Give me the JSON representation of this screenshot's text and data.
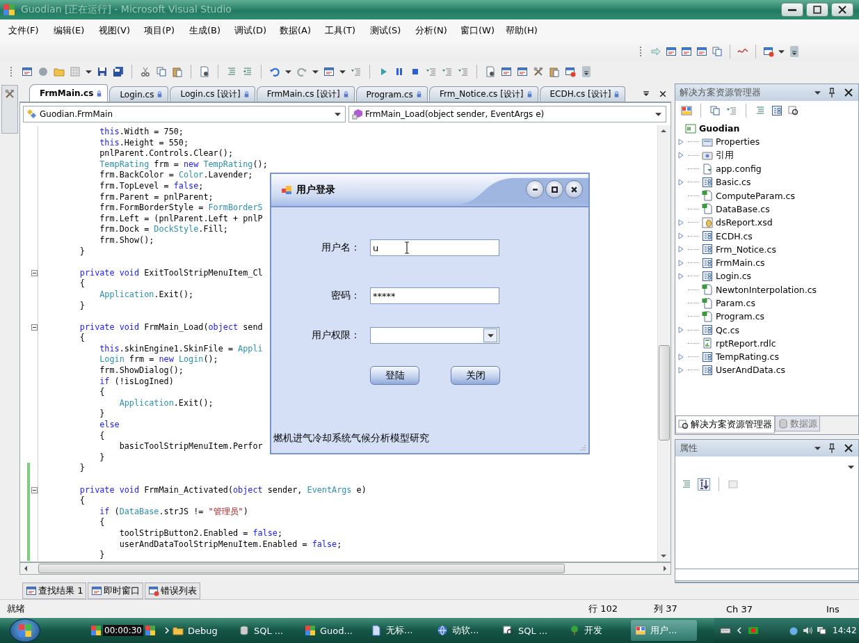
{
  "window": {
    "title": "Guodian [正在运行] - Microsoft Visual Studio"
  },
  "menu": [
    "文件(F)",
    "编辑(E)",
    "视图(V)",
    "项目(P)",
    "生成(B)",
    "调试(D)",
    "数据(A)",
    "工具(T)",
    "测试(S)",
    "分析(N)",
    "窗口(W)",
    "帮助(H)"
  ],
  "editor_tabs": [
    {
      "label": "FrmMain.cs",
      "selected": true
    },
    {
      "label": "Login.cs",
      "selected": false
    },
    {
      "label": "Login.cs [设计]",
      "selected": false
    },
    {
      "label": "FrmMain.cs [设计]",
      "selected": false
    },
    {
      "label": "Program.cs",
      "selected": false
    },
    {
      "label": "Frm_Notice.cs [设计]",
      "selected": false
    },
    {
      "label": "ECDH.cs [设计]",
      "selected": false
    }
  ],
  "type_dropdown": {
    "value": "Guodian.FrmMain"
  },
  "member_dropdown": {
    "value": "FrmMain_Load(object sender, EventArgs e)"
  },
  "code_lines": [
    {
      "tokens": [
        {
          "kind": "keyword",
          "text": "            this"
        },
        {
          "kind": "plain",
          "text": ".Width = 750;"
        }
      ],
      "fold": false,
      "changed": false
    },
    {
      "tokens": [
        {
          "kind": "keyword",
          "text": "            this"
        },
        {
          "kind": "plain",
          "text": ".Height = 550;"
        }
      ],
      "fold": false,
      "changed": false
    },
    {
      "tokens": [
        {
          "kind": "plain",
          "text": "            pnlParent.Controls.Clear();"
        }
      ],
      "fold": false,
      "changed": false
    },
    {
      "tokens": [
        {
          "kind": "type",
          "text": "            TempRating"
        },
        {
          "kind": "plain",
          "text": " frm = "
        },
        {
          "kind": "keyword",
          "text": "new "
        },
        {
          "kind": "type",
          "text": "TempRating"
        },
        {
          "kind": "plain",
          "text": "();"
        }
      ],
      "fold": false,
      "changed": false
    },
    {
      "tokens": [
        {
          "kind": "plain",
          "text": "            frm.BackColor = "
        },
        {
          "kind": "type",
          "text": "Color"
        },
        {
          "kind": "plain",
          "text": ".Lavender;"
        }
      ],
      "fold": false,
      "changed": false
    },
    {
      "tokens": [
        {
          "kind": "plain",
          "text": "            frm.TopLevel = "
        },
        {
          "kind": "keyword",
          "text": "false"
        },
        {
          "kind": "plain",
          "text": ";"
        }
      ],
      "fold": false,
      "changed": false
    },
    {
      "tokens": [
        {
          "kind": "plain",
          "text": "            frm.Parent = pnlParent;"
        }
      ],
      "fold": false,
      "changed": false
    },
    {
      "tokens": [
        {
          "kind": "plain",
          "text": "            frm.FormBorderStyle = "
        },
        {
          "kind": "type",
          "text": "FormBorderS"
        }
      ],
      "fold": false,
      "changed": false
    },
    {
      "tokens": [
        {
          "kind": "plain",
          "text": "            frm.Left = (pnlParent.Left + pnlP"
        }
      ],
      "fold": false,
      "changed": false
    },
    {
      "tokens": [
        {
          "kind": "plain",
          "text": "            frm.Dock = "
        },
        {
          "kind": "type",
          "text": "DockStyle"
        },
        {
          "kind": "plain",
          "text": ".Fill;"
        }
      ],
      "fold": false,
      "changed": false
    },
    {
      "tokens": [
        {
          "kind": "plain",
          "text": "            frm.Show();"
        }
      ],
      "fold": false,
      "changed": false
    },
    {
      "tokens": [
        {
          "kind": "plain",
          "text": "        }"
        }
      ],
      "fold": false,
      "changed": false
    },
    {
      "fold": false,
      "changed": false
    },
    {
      "tokens": [
        {
          "kind": "keyword",
          "text": "        private void"
        },
        {
          "kind": "plain",
          "text": " ExitToolStripMenuItem_Cl"
        }
      ],
      "fold": true,
      "changed": false
    },
    {
      "tokens": [
        {
          "kind": "plain",
          "text": "        {"
        }
      ],
      "fold": false,
      "changed": false
    },
    {
      "tokens": [
        {
          "kind": "type",
          "text": "            Application"
        },
        {
          "kind": "plain",
          "text": ".Exit();"
        }
      ],
      "fold": false,
      "changed": false
    },
    {
      "tokens": [
        {
          "kind": "plain",
          "text": "        }"
        }
      ],
      "fold": false,
      "changed": false
    },
    {
      "fold": false,
      "changed": false
    },
    {
      "tokens": [
        {
          "kind": "keyword",
          "text": "        private void"
        },
        {
          "kind": "plain",
          "text": " FrmMain_Load("
        },
        {
          "kind": "keyword",
          "text": "object"
        },
        {
          "kind": "plain",
          "text": " send"
        }
      ],
      "fold": true,
      "changed": false
    },
    {
      "tokens": [
        {
          "kind": "plain",
          "text": "        {"
        }
      ],
      "fold": false,
      "changed": false
    },
    {
      "tokens": [
        {
          "kind": "keyword",
          "text": "            this"
        },
        {
          "kind": "plain",
          "text": ".skinEngine1.SkinFile = "
        },
        {
          "kind": "type",
          "text": "Appli"
        }
      ],
      "fold": false,
      "changed": false
    },
    {
      "tokens": [
        {
          "kind": "type",
          "text": "            Login"
        },
        {
          "kind": "plain",
          "text": " frm = "
        },
        {
          "kind": "keyword",
          "text": "new "
        },
        {
          "kind": "type",
          "text": "Login"
        },
        {
          "kind": "plain",
          "text": "();"
        }
      ],
      "fold": false,
      "changed": false
    },
    {
      "tokens": [
        {
          "kind": "plain",
          "text": "            frm.ShowDialog();"
        }
      ],
      "fold": false,
      "changed": false
    },
    {
      "tokens": [
        {
          "kind": "keyword",
          "text": "            if"
        },
        {
          "kind": "plain",
          "text": " (!isLogIned)"
        }
      ],
      "fold": false,
      "changed": false
    },
    {
      "tokens": [
        {
          "kind": "plain",
          "text": "            {"
        }
      ],
      "fold": false,
      "changed": false
    },
    {
      "tokens": [
        {
          "kind": "type",
          "text": "                Application"
        },
        {
          "kind": "plain",
          "text": ".Exit();"
        }
      ],
      "fold": false,
      "changed": false
    },
    {
      "tokens": [
        {
          "kind": "plain",
          "text": "            }"
        }
      ],
      "fold": false,
      "changed": false
    },
    {
      "tokens": [
        {
          "kind": "keyword",
          "text": "            else"
        }
      ],
      "fold": false,
      "changed": false
    },
    {
      "tokens": [
        {
          "kind": "plain",
          "text": "            {"
        }
      ],
      "fold": false,
      "changed": false
    },
    {
      "tokens": [
        {
          "kind": "plain",
          "text": "                basicToolStripMenuItem.Perfor"
        }
      ],
      "fold": false,
      "changed": false
    },
    {
      "tokens": [
        {
          "kind": "plain",
          "text": "            }"
        }
      ],
      "fold": false,
      "changed": false
    },
    {
      "tokens": [
        {
          "kind": "plain",
          "text": "        }"
        }
      ],
      "fold": false,
      "changed": true
    },
    {
      "fold": false,
      "changed": true
    },
    {
      "tokens": [
        {
          "kind": "keyword",
          "text": "        private void"
        },
        {
          "kind": "plain",
          "text": " FrmMain_Activated("
        },
        {
          "kind": "keyword",
          "text": "object"
        },
        {
          "kind": "plain",
          "text": " sender, "
        },
        {
          "kind": "type",
          "text": "EventArgs"
        },
        {
          "kind": "plain",
          "text": " e)"
        }
      ],
      "fold": true,
      "changed": true
    },
    {
      "tokens": [
        {
          "kind": "plain",
          "text": "        {"
        }
      ],
      "fold": false,
      "changed": true
    },
    {
      "tokens": [
        {
          "kind": "keyword",
          "text": "            if"
        },
        {
          "kind": "plain",
          "text": " ("
        },
        {
          "kind": "type",
          "text": "DataBase"
        },
        {
          "kind": "plain",
          "text": ".strJS != "
        },
        {
          "kind": "string",
          "text": "\"管理员\""
        },
        {
          "kind": "plain",
          "text": ")"
        }
      ],
      "fold": false,
      "changed": true
    },
    {
      "tokens": [
        {
          "kind": "plain",
          "text": "            {"
        }
      ],
      "fold": false,
      "changed": true
    },
    {
      "tokens": [
        {
          "kind": "plain",
          "text": "                toolStripButton2.Enabled = "
        },
        {
          "kind": "keyword",
          "text": "false"
        },
        {
          "kind": "plain",
          "text": ";"
        }
      ],
      "fold": false,
      "changed": true
    },
    {
      "tokens": [
        {
          "kind": "plain",
          "text": "                userAndDataToolStripMenuItem.Enabled = "
        },
        {
          "kind": "keyword",
          "text": "false"
        },
        {
          "kind": "plain",
          "text": ";"
        }
      ],
      "fold": false,
      "changed": true
    },
    {
      "tokens": [
        {
          "kind": "plain",
          "text": "            }"
        }
      ],
      "fold": false,
      "changed": true
    }
  ],
  "output_tabs": [
    "查找结果 1",
    "即时窗口",
    "错误列表"
  ],
  "solution_explorer": {
    "title": "解决方案资源管理器",
    "project": {
      "label": "Guodian",
      "children": [
        {
          "label": "Properties",
          "kind": "properties",
          "expandable": true
        },
        {
          "label": "引用",
          "kind": "references",
          "expandable": true
        },
        {
          "label": "app.config",
          "kind": "config",
          "expandable": false
        },
        {
          "label": "Basic.cs",
          "kind": "form",
          "expandable": true
        },
        {
          "label": "ComputeParam.cs",
          "kind": "code",
          "expandable": false
        },
        {
          "label": "DataBase.cs",
          "kind": "code",
          "expandable": false
        },
        {
          "label": "dsReport.xsd",
          "kind": "dataset",
          "expandable": true
        },
        {
          "label": "ECDH.cs",
          "kind": "form",
          "expandable": true
        },
        {
          "label": "Frm_Notice.cs",
          "kind": "form",
          "expandable": true
        },
        {
          "label": "FrmMain.cs",
          "kind": "form",
          "expandable": true
        },
        {
          "label": "Login.cs",
          "kind": "form",
          "expandable": true
        },
        {
          "label": "NewtonInterpolation.cs",
          "kind": "code",
          "expandable": false
        },
        {
          "label": "Param.cs",
          "kind": "code",
          "expandable": false
        },
        {
          "label": "Program.cs",
          "kind": "code",
          "expandable": false
        },
        {
          "label": "Qc.cs",
          "kind": "form",
          "expandable": true
        },
        {
          "label": "rptReport.rdlc",
          "kind": "report",
          "expandable": false
        },
        {
          "label": "TempRating.cs",
          "kind": "form",
          "expandable": true
        },
        {
          "label": "UserAndData.cs",
          "kind": "form",
          "expandable": true
        }
      ]
    }
  },
  "panel_tabs": [
    {
      "label": "解决方案资源管理器",
      "selected": true
    },
    {
      "label": "数据源",
      "selected": false
    }
  ],
  "properties": {
    "title": "属性"
  },
  "status_bar": {
    "message": "就绪",
    "line": "行 102",
    "column": "列 37",
    "char": "Ch 37",
    "mode": "Ins"
  },
  "dialog": {
    "title": "用户登录",
    "fields": [
      {
        "label": "用户名：",
        "value": "u",
        "kind": "text"
      },
      {
        "label": "密码：",
        "value": "*****",
        "kind": "text"
      },
      {
        "label": "用户权限：",
        "kind": "combo"
      }
    ],
    "buttons": [
      "登陆",
      "关闭"
    ],
    "footer": "燃机进气冷却系统气候分析模型研究"
  },
  "taskbar": {
    "timer": "00:00:30",
    "buttons": [
      {
        "label": "Debug",
        "kind": "folder",
        "selected": false
      },
      {
        "label": "SQL ...",
        "kind": "database",
        "selected": false
      },
      {
        "label": "Guod...",
        "kind": "app",
        "selected": false
      },
      {
        "label": "无标...",
        "kind": "document",
        "selected": false
      },
      {
        "label": "动软...",
        "kind": "globe",
        "selected": false
      },
      {
        "label": "SQL ...",
        "kind": "magnifier",
        "selected": false
      },
      {
        "label": "开发",
        "kind": "tree",
        "selected": false
      },
      {
        "label": "用户...",
        "kind": "window",
        "selected": true
      }
    ],
    "clock": "14:42"
  }
}
